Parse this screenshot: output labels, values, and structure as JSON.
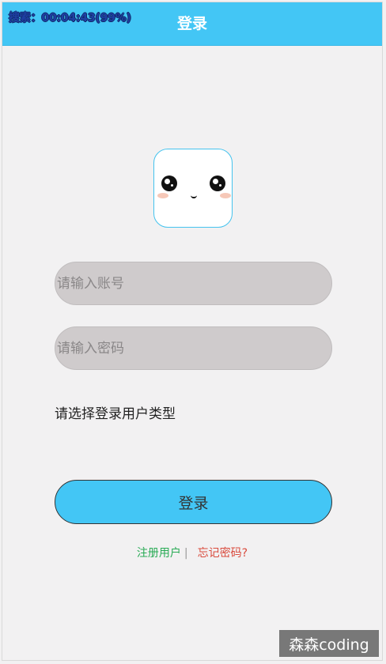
{
  "header": {
    "title": "登录",
    "search_overlay": "搜索：00:04:43(99%)"
  },
  "avatar": {
    "icon": "cute-face-icon"
  },
  "form": {
    "account_placeholder": "请输入账号",
    "password_placeholder": "请输入密码",
    "user_type_label": "请选择登录用户类型",
    "login_button": "登录"
  },
  "links": {
    "register": "注册用户",
    "separator": "|",
    "forgot_password": "忘记密码?"
  },
  "watermark": "森森coding",
  "colors": {
    "header_bg": "#43c6f5",
    "button_bg": "#43c6f5",
    "input_bg": "#cfcbcc",
    "register_link": "#2aab56",
    "forgot_link": "#d94a3c"
  }
}
